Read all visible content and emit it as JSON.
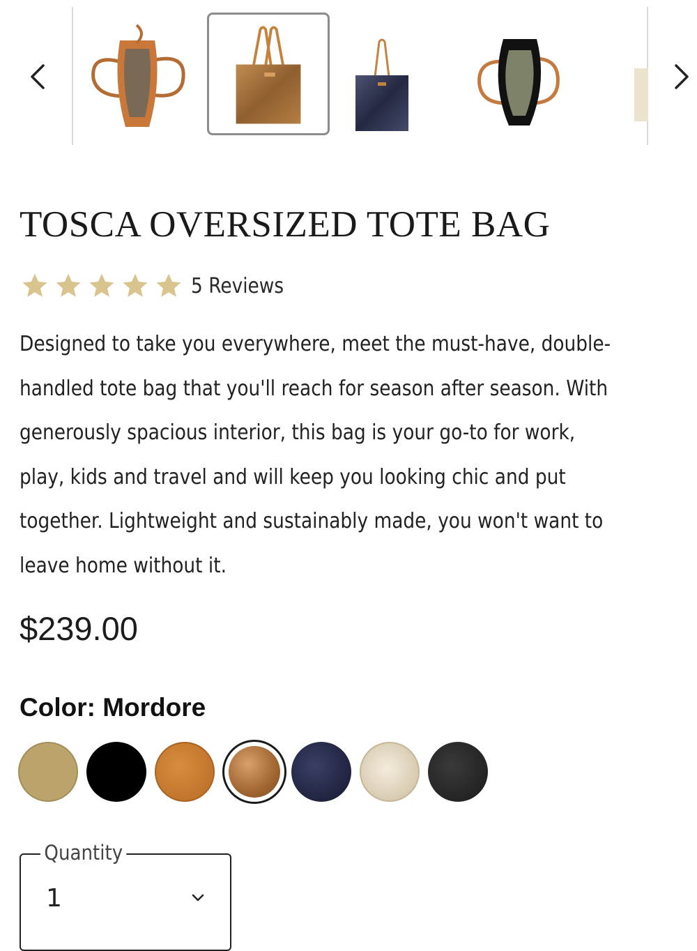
{
  "carousel": {
    "thumbnails": [
      {
        "alt": "tan tote interior view"
      },
      {
        "alt": "mordore metallic tote front view",
        "selected": true
      },
      {
        "alt": "navy metallic tote front view"
      },
      {
        "alt": "black tote interior view"
      },
      {
        "alt": "cream tote partial view"
      }
    ],
    "prev_icon": "chevron-left-icon",
    "next_icon": "chevron-right-icon"
  },
  "product": {
    "title": "TOSCA OVERSIZED TOTE BAG",
    "rating": 5,
    "reviews_label": "5 Reviews",
    "description_lines": [
      "Designed to take you everywhere, meet the must-have, double-",
      "handled tote bag that you'll reach for season after season. With",
      "generously spacious interior, this bag is your go-to for work,",
      "play, kids and travel and will keep you looking chic and put",
      "together. Lightweight and sustainably made, you won't want to",
      "leave home without it."
    ],
    "price": "$239.00",
    "color_label": "Color: Mordore"
  },
  "swatches": [
    {
      "name": "tan",
      "color": "#bba36c"
    },
    {
      "name": "black",
      "color": "#000000"
    },
    {
      "name": "cognac",
      "color": "#c97c31"
    },
    {
      "name": "mordore",
      "color": "#b57a45",
      "selected": true
    },
    {
      "name": "navy",
      "color": "#1e2347"
    },
    {
      "name": "cream",
      "color": "#e2d6c2"
    },
    {
      "name": "charcoal",
      "color": "#2a2a2a"
    }
  ],
  "quantity": {
    "label": "Quantity",
    "value": "1"
  },
  "colors": {
    "star": "#d9c48e",
    "text": "#1c1c1c",
    "selected_border": "#8c8c8c"
  }
}
